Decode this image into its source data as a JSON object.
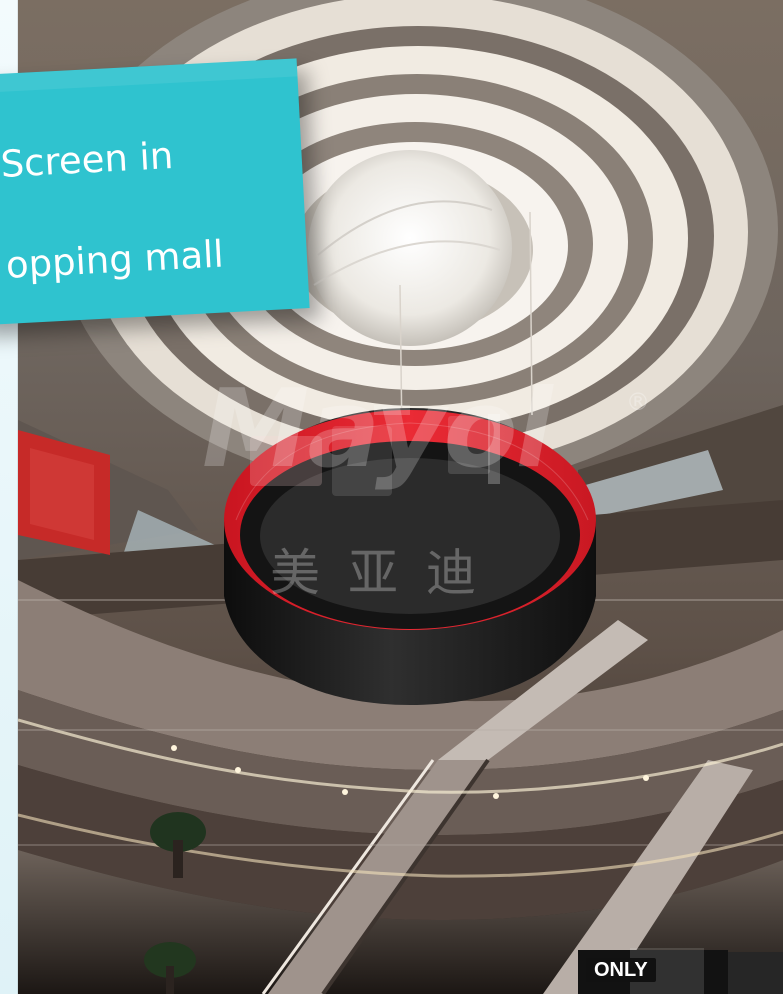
{
  "caption": {
    "line1": "Screen in",
    "line2": "opping mall"
  },
  "watermark": {
    "brand": "Mayol",
    "registered": "®",
    "chinese": "美亚迪"
  },
  "store_sign": "ONLY",
  "colors": {
    "caption_background": "#2fc3cf",
    "caption_text": "#ffffff",
    "screen_red": "#e51f2b",
    "screen_black": "#161616"
  }
}
